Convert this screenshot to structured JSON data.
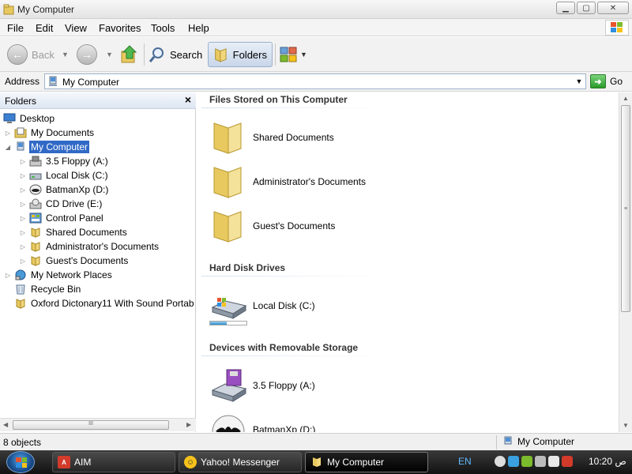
{
  "window": {
    "title": "My Computer",
    "controls": [
      "minimize",
      "maximize",
      "close"
    ]
  },
  "menu": [
    "File",
    "Edit",
    "View",
    "Favorites",
    "Tools",
    "Help"
  ],
  "toolbar": {
    "back_label": "Back",
    "search_label": "Search",
    "folders_label": "Folders"
  },
  "address": {
    "label": "Address",
    "value": "My Computer",
    "go_label": "Go"
  },
  "folders_pane": {
    "title": "Folders",
    "close_glyph": "×",
    "scroll_grip": "III",
    "tree": [
      {
        "label": "Desktop",
        "icon": "desktop-icon"
      },
      {
        "label": "My Documents",
        "icon": "documents-icon"
      },
      {
        "label": "My Computer",
        "icon": "computer-icon",
        "selected": true
      },
      {
        "label": "3.5 Floppy (A:)",
        "icon": "floppy-icon"
      },
      {
        "label": "Local Disk (C:)",
        "icon": "hard-disk-icon"
      },
      {
        "label": "BatmanXp (D:)",
        "icon": "cd-icon"
      },
      {
        "label": "CD Drive (E:)",
        "icon": "cd-drive-icon"
      },
      {
        "label": "Control Panel",
        "icon": "control-panel-icon"
      },
      {
        "label": "Shared Documents",
        "icon": "folder-icon"
      },
      {
        "label": "Administrator's Documents",
        "icon": "folder-icon"
      },
      {
        "label": "Guest's Documents",
        "icon": "folder-icon"
      },
      {
        "label": "My Network Places",
        "icon": "network-icon"
      },
      {
        "label": "Recycle Bin",
        "icon": "recycle-bin-icon"
      },
      {
        "label": "Oxford Dictonary11 With Sound Portab",
        "icon": "folder-icon"
      }
    ]
  },
  "content": {
    "groups": [
      {
        "title": "Files Stored on This Computer",
        "items": [
          {
            "label": "Shared Documents",
            "icon": "folder-icon"
          },
          {
            "label": "Administrator's Documents",
            "icon": "folder-icon"
          },
          {
            "label": "Guest's Documents",
            "icon": "folder-icon"
          }
        ]
      },
      {
        "title": "Hard Disk Drives",
        "items": [
          {
            "label": "Local Disk (C:)",
            "icon": "hard-disk-icon",
            "usage_fraction": 0.45
          }
        ]
      },
      {
        "title": "Devices with Removable Storage",
        "items": [
          {
            "label": "3.5 Floppy (A:)",
            "icon": "floppy-icon"
          },
          {
            "label": "BatmanXp (D:)",
            "icon": "cd-icon"
          }
        ]
      }
    ]
  },
  "statusbar": {
    "object_count": "8 objects",
    "location": "My Computer"
  },
  "taskbar": {
    "tasks": [
      {
        "label": "AIM",
        "icon": "aim-icon"
      },
      {
        "label": "Yahoo! Messenger",
        "icon": "yahoo-messenger-icon"
      },
      {
        "label": "My Computer",
        "icon": "folder-icon",
        "active": true
      }
    ],
    "language": "EN",
    "clock": "10:20 ﺹ"
  },
  "colors": {
    "selection": "#3169c6",
    "folder": "#e7c960",
    "taskbar": "#1e1e1e"
  }
}
